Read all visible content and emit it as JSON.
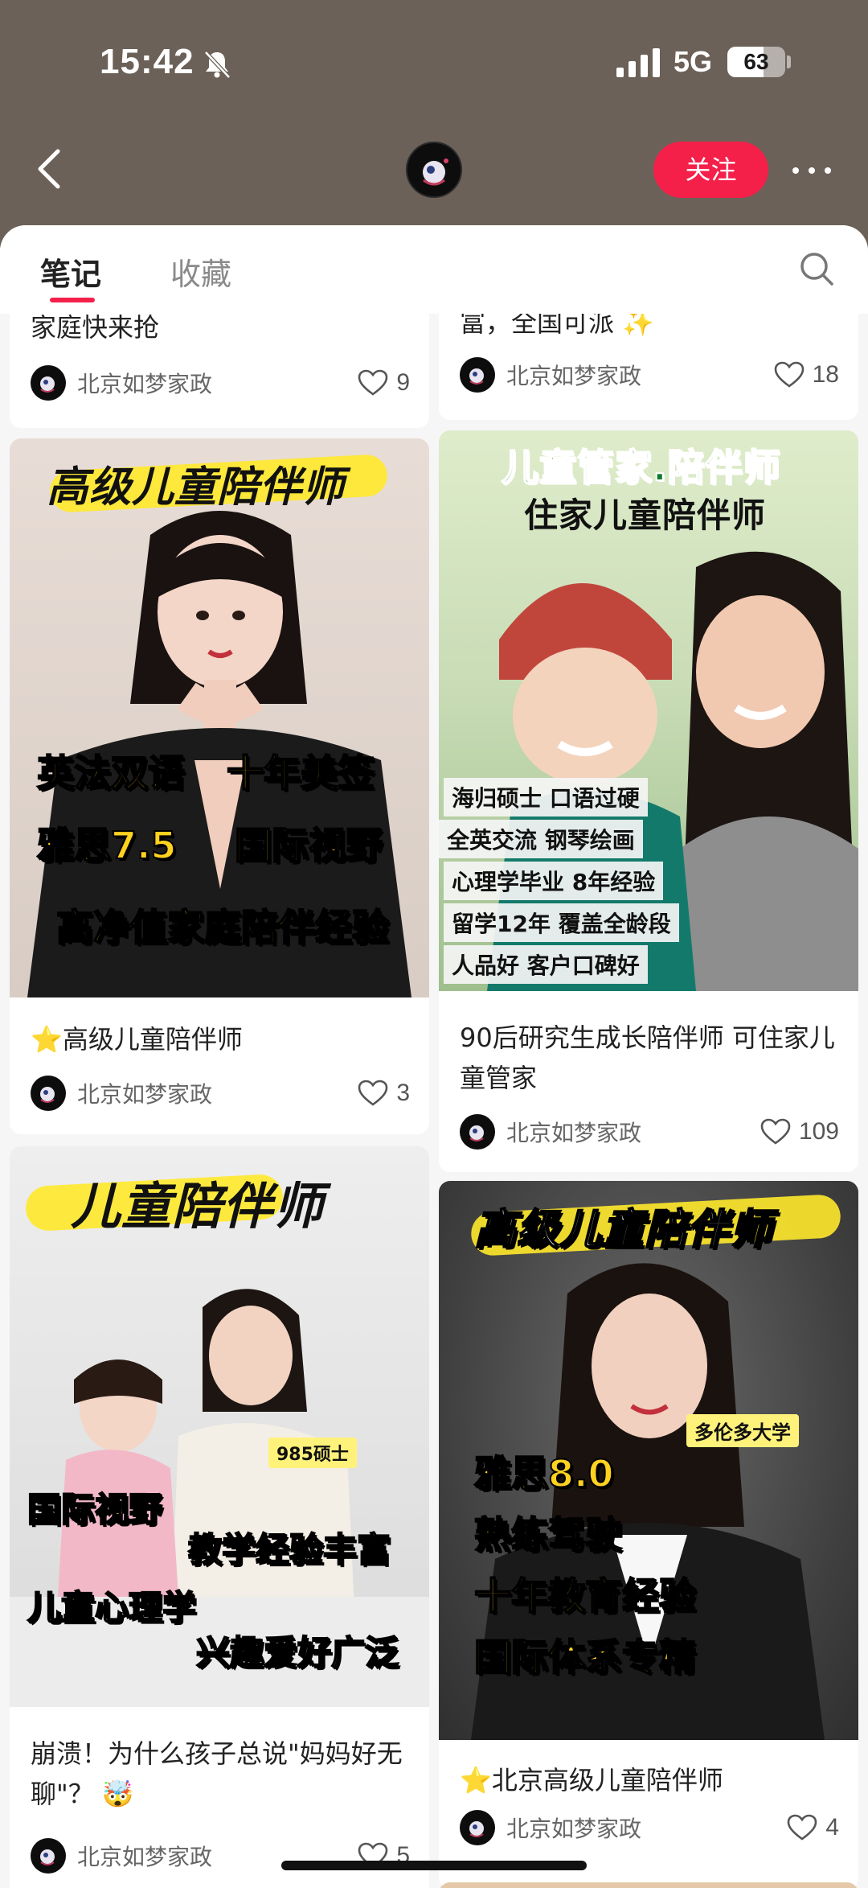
{
  "status": {
    "time": "15:42",
    "network": "5G",
    "battery": "63",
    "battery_level": 0.63
  },
  "nav": {
    "follow_label": "关注"
  },
  "tabs": [
    {
      "label": "笔记",
      "active": true
    },
    {
      "label": "收藏",
      "active": false
    }
  ],
  "cards": [
    {
      "title": "家庭快来抢",
      "author": "北京如梦家政",
      "likes": "9"
    },
    {
      "title": "富，全国可派 ✨",
      "author": "北京如梦家政",
      "likes": "18"
    },
    {
      "title": "⭐高级儿童陪伴师",
      "author": "北京如梦家政",
      "likes": "3",
      "poster": {
        "headline": "高级儿童陪伴师",
        "lines": [
          "英法双语",
          "十年美签",
          "雅思7.5",
          "国际视野",
          "高净值家庭陪伴经验"
        ]
      }
    },
    {
      "title": "90后研究生成长陪伴师 可住家儿童管家",
      "author": "北京如梦家政",
      "likes": "109",
      "poster": {
        "headline1": "儿童管家.陪伴师",
        "headline2": "住家儿童陪伴师",
        "chips": [
          "海归硕士 口语过硬",
          "全英交流 钢琴绘画",
          "心理学毕业 8年经验",
          "留学12年 覆盖全龄段",
          "人品好 客户口碑好"
        ]
      }
    },
    {
      "title": "崩溃！为什么孩子总说\"妈妈好无聊\"？ 🤯",
      "author": "北京如梦家政",
      "likes": "5",
      "poster": {
        "headline": "儿童陪伴师",
        "badge": "985硕士",
        "lines": [
          "国际视野",
          "教学经验丰富",
          "儿童心理学",
          "兴趣爱好广泛"
        ]
      }
    },
    {
      "title": "⭐北京高级儿童陪伴师",
      "author": "北京如梦家政",
      "likes": "4",
      "poster": {
        "headline": "高级儿童陪伴师",
        "badge": "多伦多大学",
        "lines": [
          "雅思8.0",
          "熟练驾驶",
          "十年教育经验",
          "国际体系专精"
        ]
      }
    }
  ]
}
